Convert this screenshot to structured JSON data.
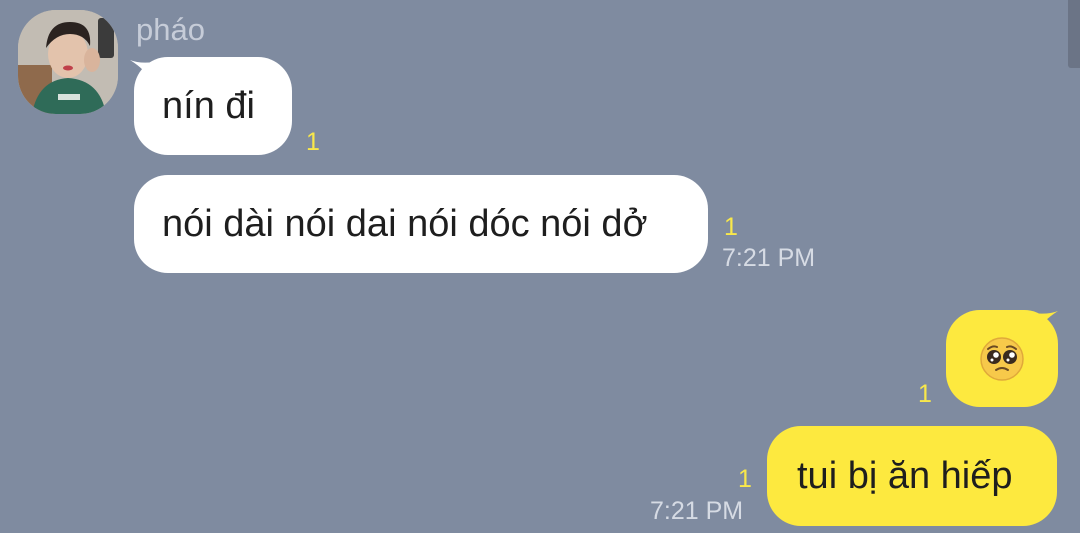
{
  "chat": {
    "sender_name": "pháo",
    "messages": [
      {
        "direction": "incoming",
        "text": "nín đi",
        "unread_count": "1",
        "time": ""
      },
      {
        "direction": "incoming",
        "text": "nói dài nói dai nói dóc nói dở",
        "unread_count": "1",
        "time": "7:21 PM"
      },
      {
        "direction": "outgoing",
        "text": "🥺",
        "emoji_icon": "pleading-face-emoji",
        "unread_count": "1",
        "time": ""
      },
      {
        "direction": "outgoing",
        "text": "tui bị ăn hiếp",
        "unread_count": "1",
        "time": "7:21 PM"
      }
    ]
  },
  "colors": {
    "background": "#7f8ba0",
    "incoming_bubble": "#ffffff",
    "outgoing_bubble": "#fde93f",
    "unread_count": "#f9e84a",
    "timestamp": "#d6dbe4"
  }
}
